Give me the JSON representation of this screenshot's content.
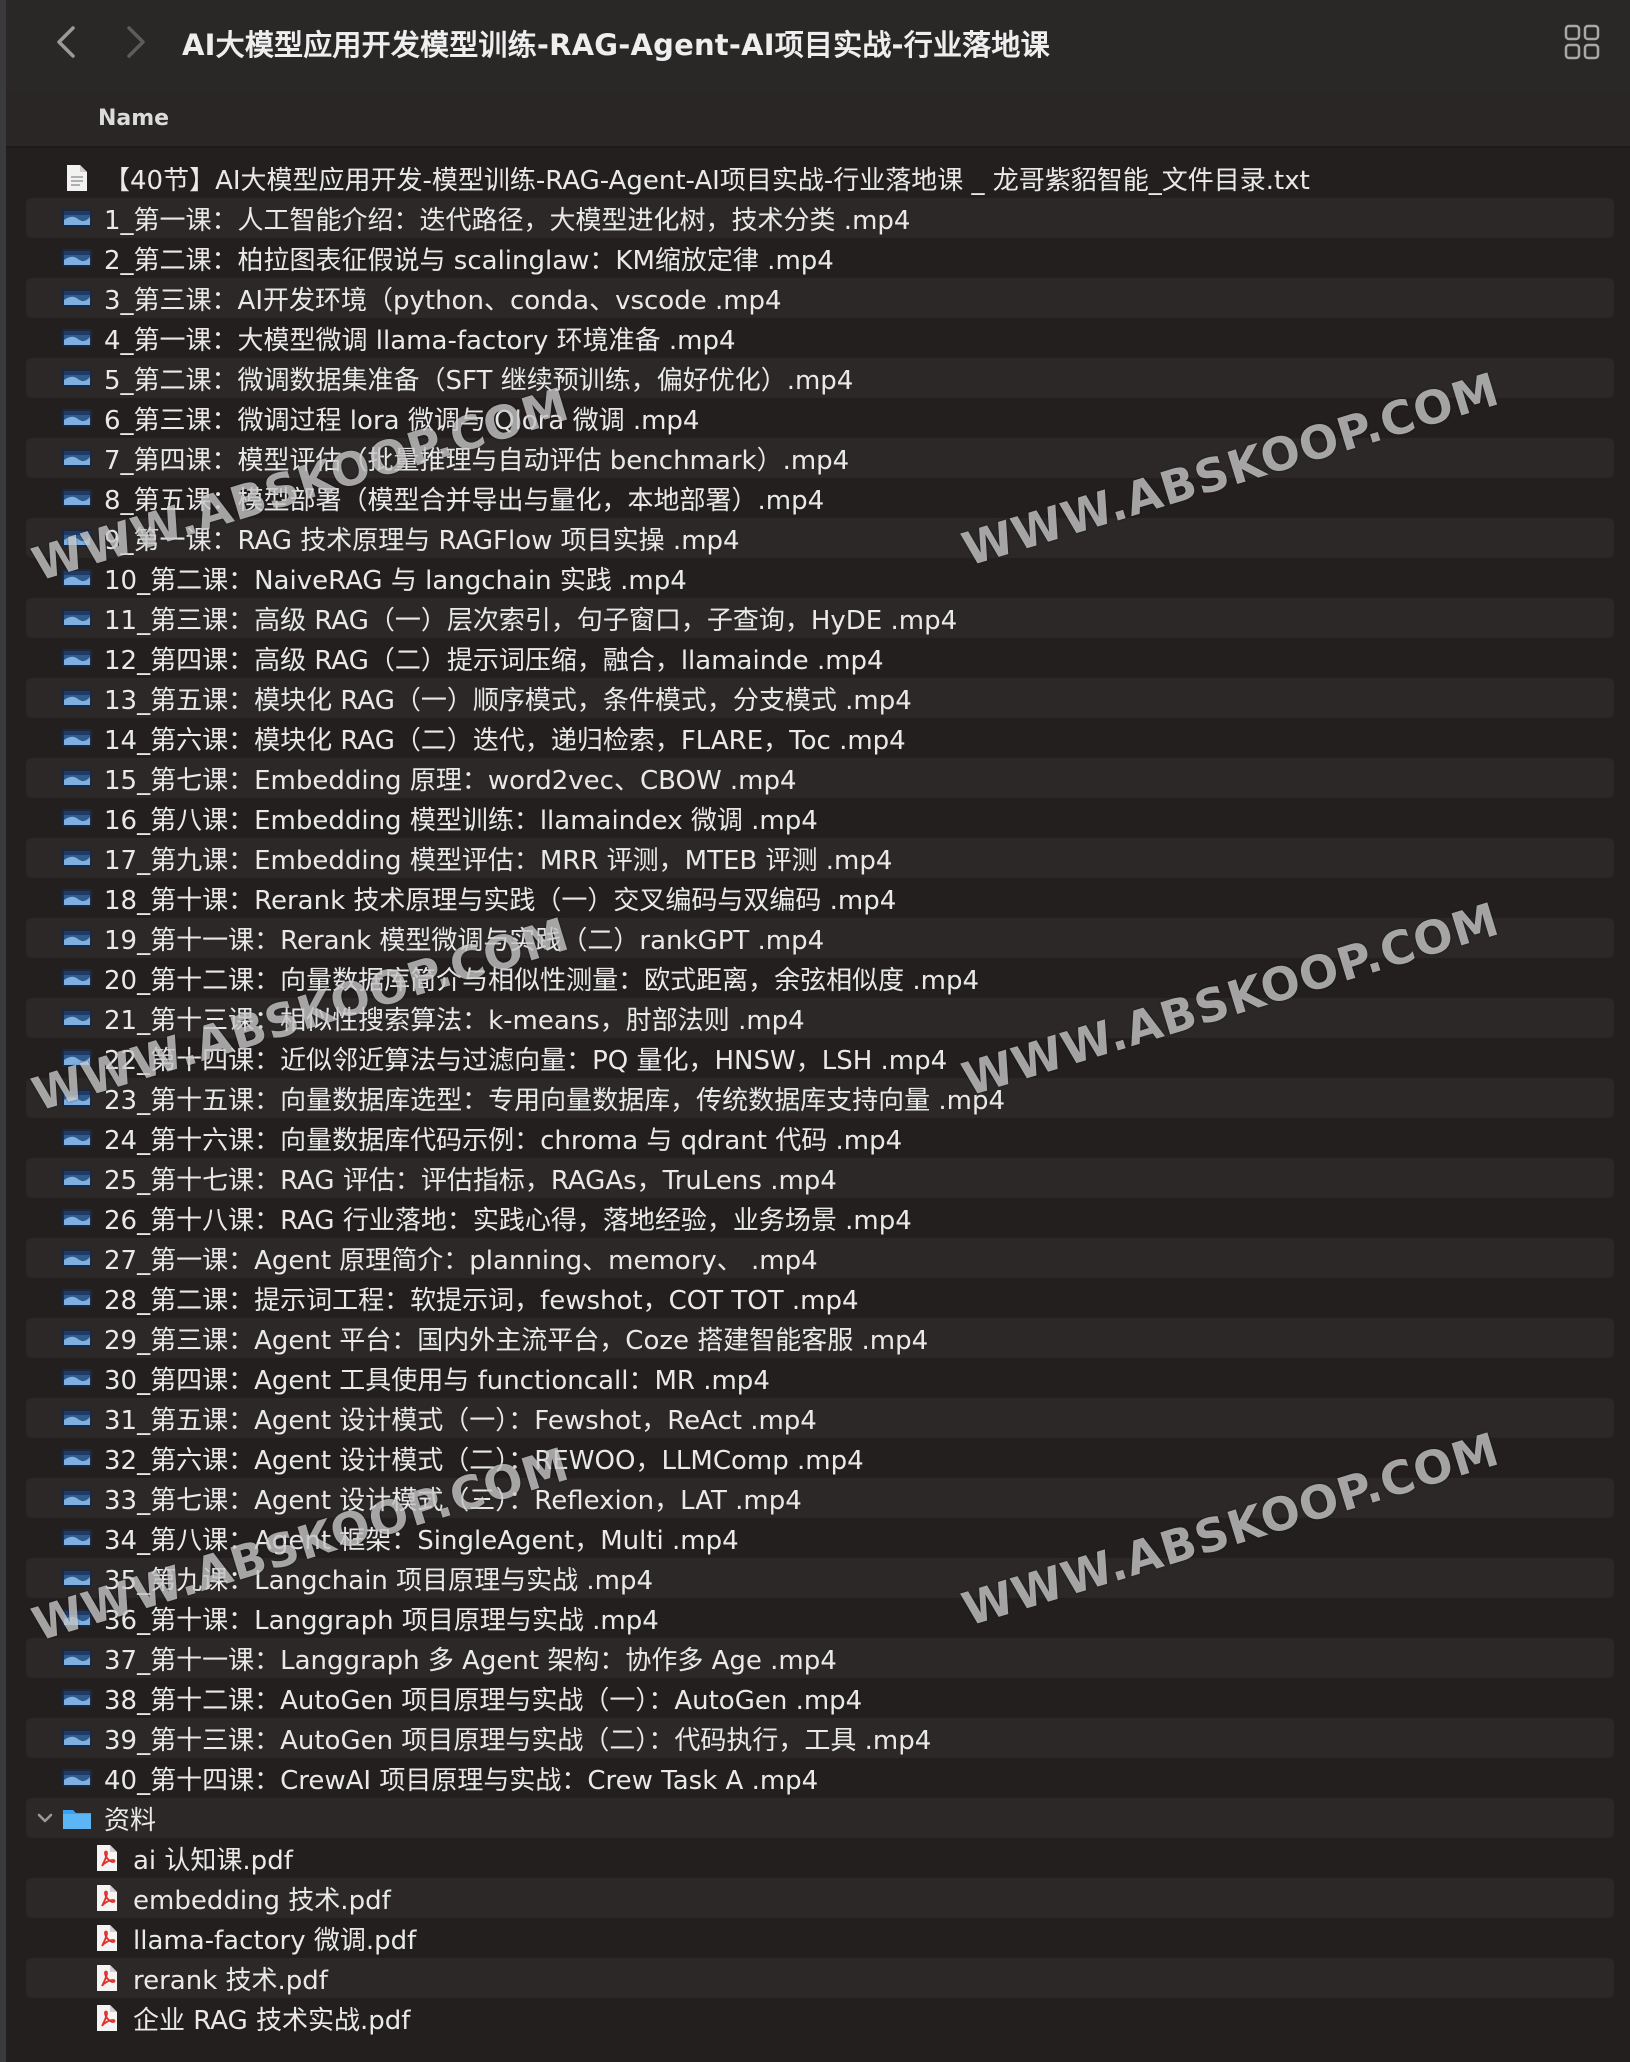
{
  "window": {
    "title": "AI大模型应用开发模型训练-RAG-Agent-AI项目实战-行业落地课"
  },
  "header": {
    "name_column": "Name"
  },
  "files": [
    {
      "name": "【40节】AI大模型应用开发-模型训练-RAG-Agent-AI项目实战-行业落地课 _ 龙哥紫貂智能_文件目录.txt",
      "type": "txt"
    },
    {
      "name": "1_第一课：人工智能介绍：迭代路径，大模型进化树，技术分类 .mp4",
      "type": "video"
    },
    {
      "name": "2_第二课：柏拉图表征假说与 scalinglaw：KM缩放定律 .mp4",
      "type": "video"
    },
    {
      "name": "3_第三课：AI开发环境（python、conda、vscode .mp4",
      "type": "video"
    },
    {
      "name": "4_第一课：大模型微调 llama-factory 环境准备 .mp4",
      "type": "video"
    },
    {
      "name": "5_第二课：微调数据集准备（SFT 继续预训练，偏好优化）.mp4",
      "type": "video"
    },
    {
      "name": "6_第三课：微调过程 lora 微调与 Qlora 微调 .mp4",
      "type": "video"
    },
    {
      "name": "7_第四课：模型评估（批量推理与自动评估 benchmark）.mp4",
      "type": "video"
    },
    {
      "name": "8_第五课：模型部署（模型合并导出与量化，本地部署）.mp4",
      "type": "video"
    },
    {
      "name": "9_第一课：RAG 技术原理与 RAGFlow 项目实操 .mp4",
      "type": "video"
    },
    {
      "name": "10_第二课：NaiveRAG 与 langchain 实践 .mp4",
      "type": "video"
    },
    {
      "name": "11_第三课：高级 RAG（一）层次索引，句子窗口，子查询，HyDE .mp4",
      "type": "video"
    },
    {
      "name": "12_第四课：高级 RAG（二）提示词压缩，融合，llamainde .mp4",
      "type": "video"
    },
    {
      "name": "13_第五课：模块化 RAG（一）顺序模式，条件模式，分支模式 .mp4",
      "type": "video"
    },
    {
      "name": "14_第六课：模块化 RAG（二）迭代，递归检索，FLARE，Toc .mp4",
      "type": "video"
    },
    {
      "name": "15_第七课：Embedding 原理：word2vec、CBOW .mp4",
      "type": "video"
    },
    {
      "name": "16_第八课：Embedding 模型训练：llamaindex 微调 .mp4",
      "type": "video"
    },
    {
      "name": "17_第九课：Embedding 模型评估：MRR 评测，MTEB 评测 .mp4",
      "type": "video"
    },
    {
      "name": "18_第十课：Rerank 技术原理与实践（一）交叉编码与双编码 .mp4",
      "type": "video"
    },
    {
      "name": "19_第十一课：Rerank 模型微调与实践（二）rankGPT .mp4",
      "type": "video"
    },
    {
      "name": "20_第十二课：向量数据库简介与相似性测量：欧式距离，余弦相似度 .mp4",
      "type": "video"
    },
    {
      "name": "21_第十三课：相似性搜索算法：k-means，肘部法则 .mp4",
      "type": "video"
    },
    {
      "name": "22_第十四课：近似邻近算法与过滤向量：PQ 量化，HNSW，LSH .mp4",
      "type": "video"
    },
    {
      "name": "23_第十五课：向量数据库选型：专用向量数据库，传统数据库支持向量 .mp4",
      "type": "video"
    },
    {
      "name": "24_第十六课：向量数据库代码示例：chroma 与 qdrant 代码 .mp4",
      "type": "video"
    },
    {
      "name": "25_第十七课：RAG 评估：评估指标，RAGAs，TruLens .mp4",
      "type": "video"
    },
    {
      "name": "26_第十八课：RAG 行业落地：实践心得，落地经验，业务场景 .mp4",
      "type": "video"
    },
    {
      "name": "27_第一课：Agent 原理简介：planning、memory、 .mp4",
      "type": "video"
    },
    {
      "name": "28_第二课：提示词工程：软提示词，fewshot，COT TOT .mp4",
      "type": "video"
    },
    {
      "name": "29_第三课：Agent 平台：国内外主流平台，Coze 搭建智能客服 .mp4",
      "type": "video"
    },
    {
      "name": "30_第四课：Agent 工具使用与 functioncall：MR .mp4",
      "type": "video"
    },
    {
      "name": "31_第五课：Agent 设计模式（一）：Fewshot，ReAct .mp4",
      "type": "video"
    },
    {
      "name": "32_第六课：Agent 设计模式（二）：REWOO，LLMComp .mp4",
      "type": "video"
    },
    {
      "name": "33_第七课：Agent 设计模式（三）：Reflexion，LAT .mp4",
      "type": "video"
    },
    {
      "name": "34_第八课：Agent 框架：SingleAgent，Multi .mp4",
      "type": "video"
    },
    {
      "name": "35_第九课：Langchain 项目原理与实战 .mp4",
      "type": "video"
    },
    {
      "name": "36_第十课：Langgraph 项目原理与实战 .mp4",
      "type": "video"
    },
    {
      "name": "37_第十一课：Langgraph 多 Agent 架构：协作多 Age .mp4",
      "type": "video"
    },
    {
      "name": "38_第十二课：AutoGen 项目原理与实战（一）：AutoGen .mp4",
      "type": "video"
    },
    {
      "name": "39_第十三课：AutoGen 项目原理与实战（二）：代码执行，工具 .mp4",
      "type": "video"
    },
    {
      "name": "40_第十四课：CrewAI 项目原理与实战：Crew Task A .mp4",
      "type": "video"
    }
  ],
  "folder": {
    "name": "资料",
    "children": [
      {
        "name": "ai 认知课.pdf",
        "type": "pdf"
      },
      {
        "name": "embedding 技术.pdf",
        "type": "pdf"
      },
      {
        "name": "llama-factory 微调.pdf",
        "type": "pdf"
      },
      {
        "name": "rerank 技术.pdf",
        "type": "pdf"
      },
      {
        "name": "企业 RAG 技术实战.pdf",
        "type": "pdf"
      }
    ]
  },
  "watermark_text": "WWW.ABSKOOP.COM",
  "colors": {
    "background": "#241f1f",
    "row_alt": "#2c2828",
    "folder": "#3aa0f0",
    "pdf": "#e0322a"
  }
}
